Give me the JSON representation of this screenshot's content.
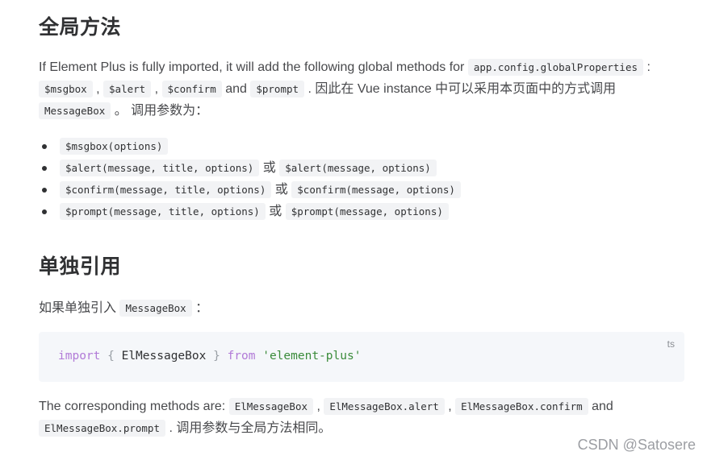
{
  "sections": {
    "global": {
      "title": "全局方法",
      "intro": {
        "t1": "If Element Plus is fully imported, it will add the following global methods for ",
        "c1": "app.config.globalProperties",
        "t2": " : ",
        "c2": "$msgbox",
        "t3": " , ",
        "c3": "$alert",
        "t4": " , ",
        "c4": "$confirm",
        "t5": " and ",
        "c5": "$prompt",
        "t6": " . 因此在 Vue instance 中可以采用本页面中的方式调用 ",
        "c6": "MessageBox",
        "t7": " 。 调用参数为："
      },
      "items": [
        {
          "code1": "$msgbox(options)",
          "sep": "",
          "code2": ""
        },
        {
          "code1": "$alert(message, title, options)",
          "sep": " 或 ",
          "code2": "$alert(message, options)"
        },
        {
          "code1": "$confirm(message, title, options)",
          "sep": " 或 ",
          "code2": "$confirm(message, options)"
        },
        {
          "code1": "$prompt(message, title, options)",
          "sep": " 或 ",
          "code2": "$prompt(message, options)"
        }
      ]
    },
    "single": {
      "title": "单独引用",
      "intro": {
        "t1": "如果单独引入 ",
        "c1": "MessageBox",
        "t2": " ："
      },
      "code": {
        "lang": "ts",
        "kw_import": "import",
        "brace_open": "{",
        "identifier": "ElMessageBox",
        "brace_close": "}",
        "kw_from": "from",
        "module": "'element-plus'"
      },
      "methods": {
        "t1": "The corresponding methods are: ",
        "c1": "ElMessageBox",
        "t2": " , ",
        "c2": "ElMessageBox.alert",
        "t3": " , ",
        "c3": "ElMessageBox.confirm",
        "t4": " and ",
        "c4": "ElMessageBox.prompt",
        "t5": " . 调用参数与全局方法相同。"
      }
    }
  },
  "watermark": "CSDN @Satosere"
}
